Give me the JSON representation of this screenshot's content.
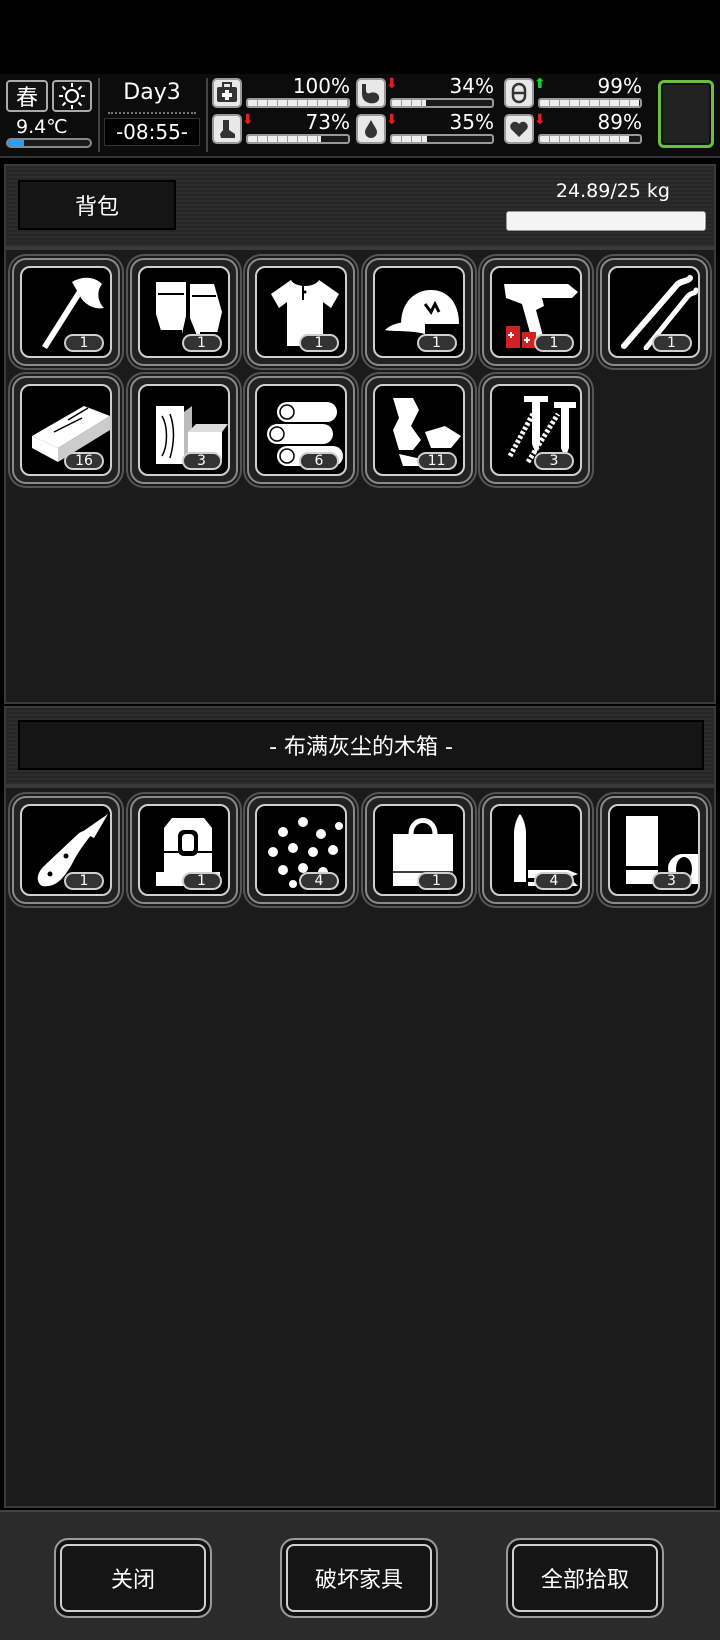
{
  "hud": {
    "season": "春",
    "weather_icon": "sun-icon",
    "temperature": "9.4℃",
    "temperature_level": 0.2,
    "day": "Day3",
    "clock": "-08:55-",
    "stats": [
      {
        "name": "health",
        "icon": "first-aid-icon",
        "value": "100%",
        "level": 1.0,
        "trend": "none"
      },
      {
        "name": "hunger",
        "icon": "stomach-icon",
        "value": "34%",
        "level": 0.34,
        "trend": "down"
      },
      {
        "name": "medicine",
        "icon": "pill-icon",
        "value": "99%",
        "level": 0.99,
        "trend": "up"
      },
      {
        "name": "stamina",
        "icon": "foot-icon",
        "value": "73%",
        "level": 0.73,
        "trend": "down"
      },
      {
        "name": "thirst",
        "icon": "water-drop-icon",
        "value": "35%",
        "level": 0.35,
        "trend": "down"
      },
      {
        "name": "mood",
        "icon": "heart-icon",
        "value": "89%",
        "level": 0.89,
        "trend": "down"
      }
    ],
    "colors": {
      "down": "#e02020",
      "up": "#22cc22",
      "portrait_border": "#6cbf3a"
    }
  },
  "backpack": {
    "title": "背包",
    "weight": "24.89/25 kg",
    "weight_level": 0.9956,
    "items": [
      {
        "icon": "axe-icon",
        "qty": "1"
      },
      {
        "icon": "gloves-icon",
        "qty": "1"
      },
      {
        "icon": "shirt-icon",
        "qty": "1"
      },
      {
        "icon": "cap-icon",
        "qty": "1"
      },
      {
        "icon": "flare-gun-icon",
        "qty": "1"
      },
      {
        "icon": "lockpick-icon",
        "qty": "1"
      },
      {
        "icon": "plank-icon",
        "qty": "16"
      },
      {
        "icon": "wood-block-icon",
        "qty": "3"
      },
      {
        "icon": "logs-icon",
        "qty": "6"
      },
      {
        "icon": "scrap-cloth-icon",
        "qty": "11"
      },
      {
        "icon": "screws-icon",
        "qty": "3"
      }
    ]
  },
  "container": {
    "title": "- 布满灰尘的木箱 -",
    "items": [
      {
        "icon": "folding-knife-icon",
        "qty": "1"
      },
      {
        "icon": "backpack-icon",
        "qty": "1"
      },
      {
        "icon": "beads-icon",
        "qty": "4"
      },
      {
        "icon": "tote-bag-icon",
        "qty": "1"
      },
      {
        "icon": "bullets-icon",
        "qty": "4"
      },
      {
        "icon": "battery-icon",
        "qty": "3"
      }
    ]
  },
  "buttons": {
    "close": "关闭",
    "destroy": "破坏家具",
    "take_all": "全部拾取"
  }
}
